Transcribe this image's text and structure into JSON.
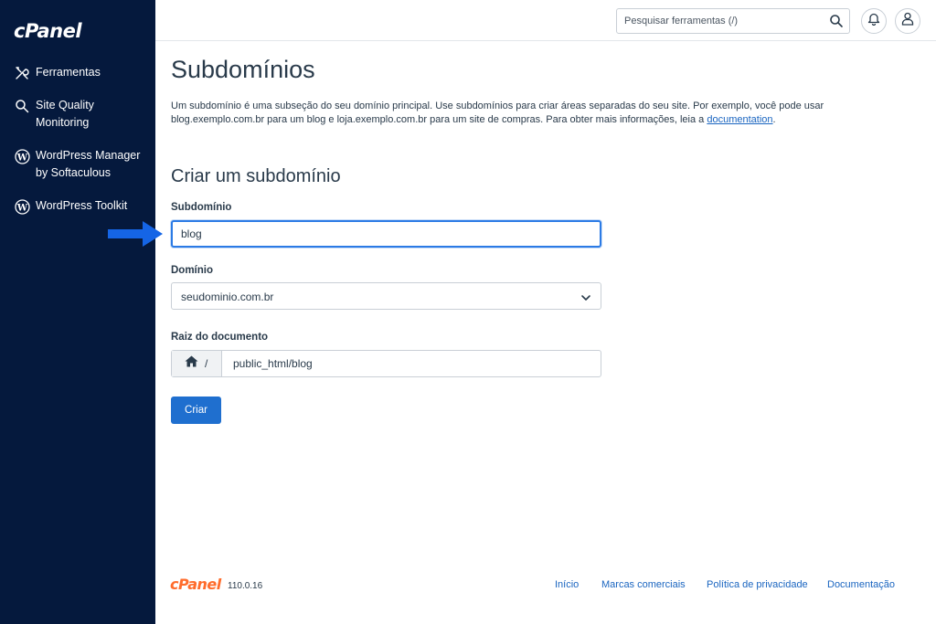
{
  "app": {
    "logo_text": "cPanel"
  },
  "sidebar": {
    "items": [
      {
        "label": "Ferramentas",
        "icon": "tools-icon"
      },
      {
        "label": "Site Quality Monitoring",
        "icon": "magnifier-icon"
      },
      {
        "label": "WordPress Manager by Softaculous",
        "line1": "WordPress Manager",
        "line2": "by Softaculous",
        "icon": "wordpress-icon"
      },
      {
        "label": "WordPress Toolkit",
        "icon": "wordpress-icon"
      }
    ]
  },
  "topbar": {
    "search_placeholder": "Pesquisar ferramentas (/)"
  },
  "main": {
    "title": "Subdomínios",
    "intro_text": "Um subdomínio é uma subseção do seu domínio principal. Use subdomínios para criar áreas separadas do seu site. Por exemplo, você pode usar blog.exemplo.com.br para um blog e loja.exemplo.com.br para um site de compras. Para obter mais informações, leia a ",
    "intro_link": "documentation",
    "intro_end": ".",
    "section_title": "Criar um subdomínio",
    "subdomain": {
      "label": "Subdomínio",
      "value": "blog"
    },
    "domain": {
      "label": "Domínio",
      "selected": "seudominio.com.br"
    },
    "docroot": {
      "label": "Raiz do documento",
      "prefix": "/",
      "value": "public_html/blog"
    },
    "create_button": "Criar"
  },
  "footer": {
    "logo_text": "cPanel",
    "version": "110.0.16",
    "links": [
      "Início",
      "Marcas comerciais",
      "Política de privacidade",
      "Documentação"
    ]
  },
  "colors": {
    "sidebar_bg": "#05193d",
    "primary": "#1f6fcf",
    "arrow": "#1565e6",
    "footer_logo": "#ff6c2c"
  }
}
